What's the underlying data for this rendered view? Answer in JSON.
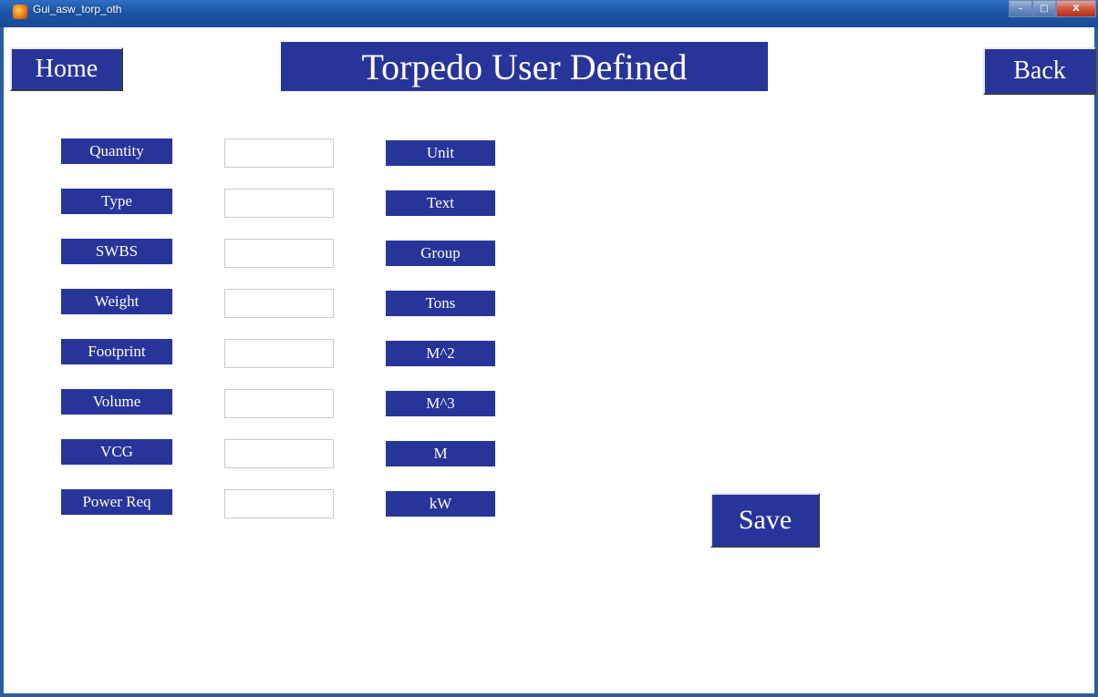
{
  "window": {
    "title": "Gui_asw_torp_oth",
    "controls": {
      "minimize": "–",
      "maximize": "□",
      "close": "X"
    }
  },
  "header": {
    "home_label": "Home",
    "title": "Torpedo User Defined",
    "back_label": "Back"
  },
  "form": {
    "rows": [
      {
        "label": "Quantity",
        "value": "",
        "unit": "Unit"
      },
      {
        "label": "Type",
        "value": "",
        "unit": "Text"
      },
      {
        "label": "SWBS",
        "value": "",
        "unit": "Group"
      },
      {
        "label": "Weight",
        "value": "",
        "unit": "Tons"
      },
      {
        "label": "Footprint",
        "value": "",
        "unit": "M^2"
      },
      {
        "label": "Volume",
        "value": "",
        "unit": "M^3"
      },
      {
        "label": "VCG",
        "value": "",
        "unit": "M"
      },
      {
        "label": "Power Req",
        "value": "",
        "unit": "kW"
      }
    ]
  },
  "actions": {
    "save_label": "Save"
  },
  "colors": {
    "button_blue": "#27359a",
    "titlebar_blue": "#1d55a8"
  }
}
